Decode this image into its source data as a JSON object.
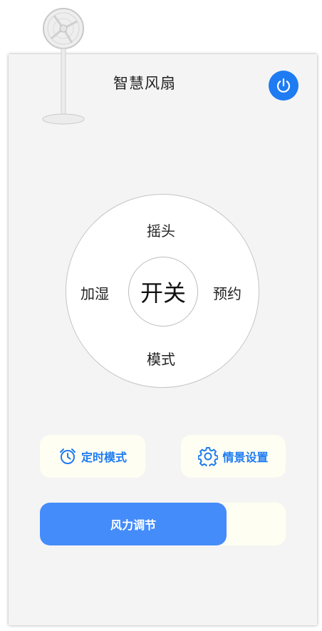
{
  "header": {
    "title": "智慧风扇",
    "power_icon": "power-icon"
  },
  "dial": {
    "top": "摇头",
    "left": "加湿",
    "right": "预约",
    "bottom": "模式",
    "center": "开关"
  },
  "buttons": {
    "timer": {
      "label": "定时模式",
      "icon": "alarm-clock-icon"
    },
    "scene": {
      "label": "情景设置",
      "icon": "gear-icon"
    }
  },
  "wind": {
    "label": "风力调节",
    "level": 0.76
  },
  "colors": {
    "accent": "#1e7bf2",
    "slider": "#448cfa",
    "card_bg": "#fffef3",
    "panel_bg": "#f4f4f4"
  }
}
